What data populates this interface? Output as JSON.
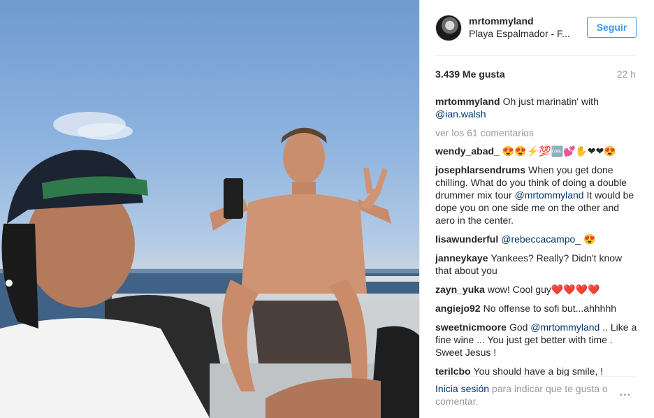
{
  "photo": {
    "alt": "Selfie on a boat at sea"
  },
  "header": {
    "username": "mrtommyland",
    "location": "Playa Espalmador - F...",
    "follow_label": "Seguir"
  },
  "stats": {
    "likes": "3.439 Me gusta",
    "time": "22 h"
  },
  "caption": {
    "author": "mrtommyland",
    "text": "Oh just marinatin' with ",
    "mention": "@ian.walsh"
  },
  "view_all": "ver los 61 comentarios",
  "comments": [
    {
      "author": "wendy_abad_",
      "text": "😍😍⚡💯🆒💕✋❤❤😍"
    },
    {
      "author": "josephlarsendrums",
      "text": "When you get done chilling. What do you think of doing a double drummer mix tour ",
      "mention": "@mrtommyland",
      "text2": " It would be dope you on one side me on the other and aero in the center."
    },
    {
      "author": "lisawunderful",
      "text": "",
      "mention": "@rebeccacampo_",
      "text2": " 😍"
    },
    {
      "author": "janneykaye",
      "text": "Yankees? Really? Didn't know that about you"
    },
    {
      "author": "zayn_yuka",
      "text": "wow! Cool guy❤️❤️❤️❤️"
    },
    {
      "author": "angiejo92",
      "text": "No offense to sofi but...ahhhhh"
    },
    {
      "author": "sweetnicmoore",
      "text": "God ",
      "mention": "@mrtommyland",
      "text2": " .. Like a fine wine ... You just get better with time . Sweet Jesus !"
    },
    {
      "author": "terilcbo",
      "text": "You should have a big smile, !"
    }
  ],
  "footer": {
    "login_label": "Inicia sesión",
    "rest": " para indicar que te gusta o comentar.",
    "more_icon": "•••"
  },
  "colors": {
    "link_blue": "#3897f0",
    "mention_blue": "#003569",
    "muted_gray": "#999999"
  }
}
